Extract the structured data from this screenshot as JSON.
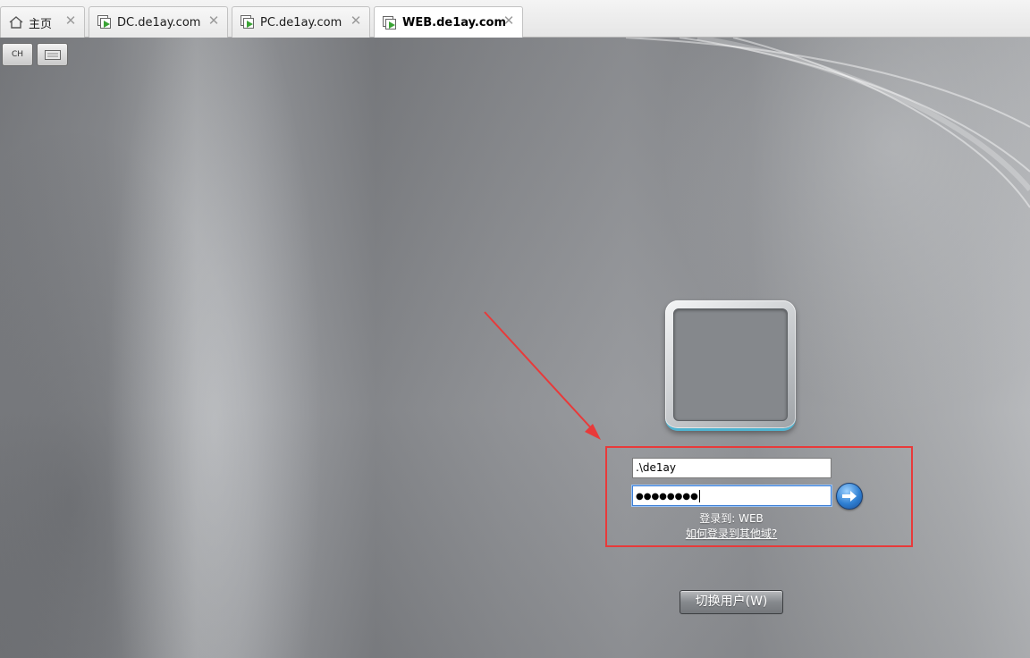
{
  "tabs": [
    {
      "label": "主页",
      "icon": "home-icon",
      "active": false
    },
    {
      "label": "DC.de1ay.com",
      "icon": "vm-icon",
      "active": false
    },
    {
      "label": "PC.de1ay.com",
      "icon": "vm-icon",
      "active": false
    },
    {
      "label": "WEB.de1ay.com",
      "icon": "vm-icon",
      "active": true
    }
  ],
  "toolbar": {
    "lang_label": "CH",
    "keyboard_icon": "keyboard-icon"
  },
  "logon": {
    "username_value": ".\\de1ay",
    "password_mask": "●●●●●●●●",
    "submit_icon": "arrow-right-icon",
    "logon_to": "登录到: WEB",
    "other_domain_link": "如何登录到其他域?",
    "switch_user_label": "切换用户(W)"
  },
  "annotation": {
    "color": "#e83a3a"
  }
}
